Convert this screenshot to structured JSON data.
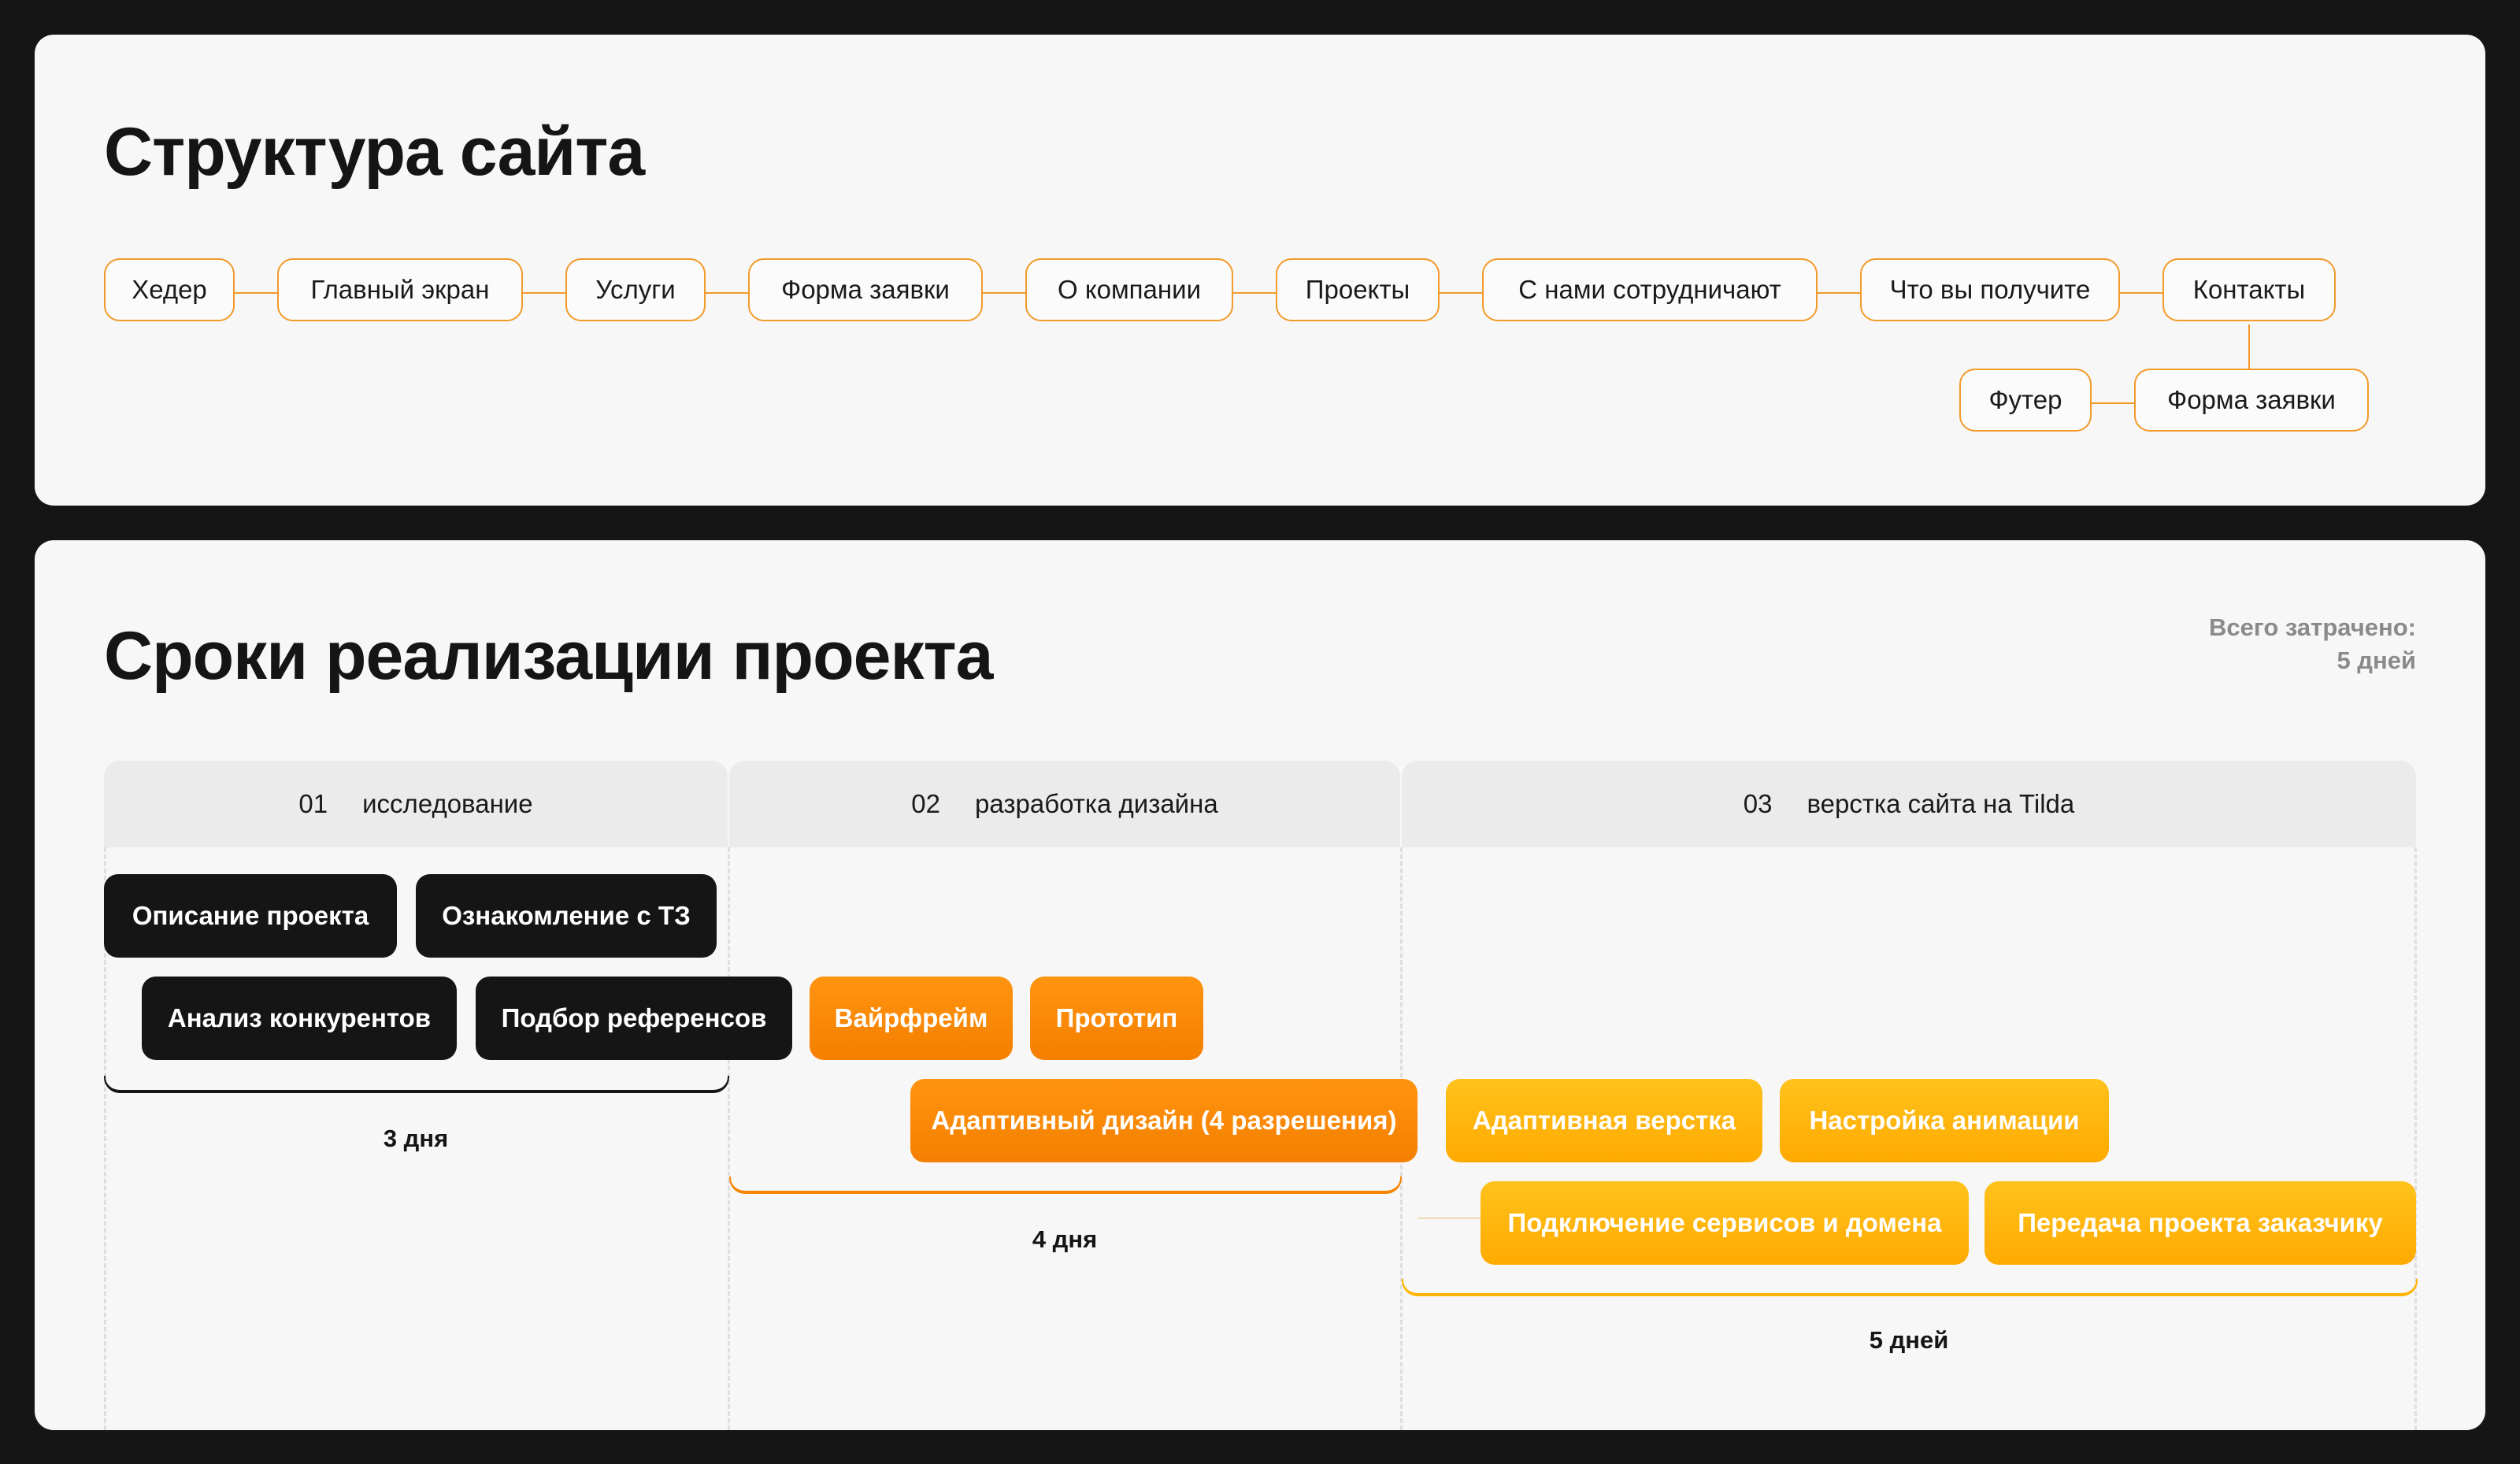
{
  "structure": {
    "title": "Структура сайта",
    "row1": [
      "Хедер",
      "Главный экран",
      "Услуги",
      "Форма заявки",
      "О компании",
      "Проекты",
      "С нами сотрудничают",
      "Что вы получите",
      "Контакты"
    ],
    "row2": [
      "Футер",
      "Форма заявки"
    ]
  },
  "timeline": {
    "title": "Сроки реализации проекта",
    "total_label": "Всего затрачено:",
    "total_value": "5 дней",
    "phases": [
      {
        "num": "01",
        "label": "исследование",
        "duration": "3 дня"
      },
      {
        "num": "02",
        "label": "разработка дизайна",
        "duration": "4 дня"
      },
      {
        "num": "03",
        "label": "верстка сайта на Tilda",
        "duration": "5 дней"
      }
    ],
    "tasks": [
      "Описание проекта",
      "Ознакомление с ТЗ",
      "Анализ конкурентов",
      "Подбор референсов",
      "Вайрфрейм",
      "Прототип",
      "Адаптивный дизайн (4 разрешения)",
      "Адаптивная верстка",
      "Настройка анимации",
      "Подключение сервисов и домена",
      "Передача проекта заказчику"
    ],
    "colors": {
      "research": "#151515",
      "design": "#f78500",
      "dev": "#ffb400",
      "connector": "#f29a2a"
    }
  }
}
